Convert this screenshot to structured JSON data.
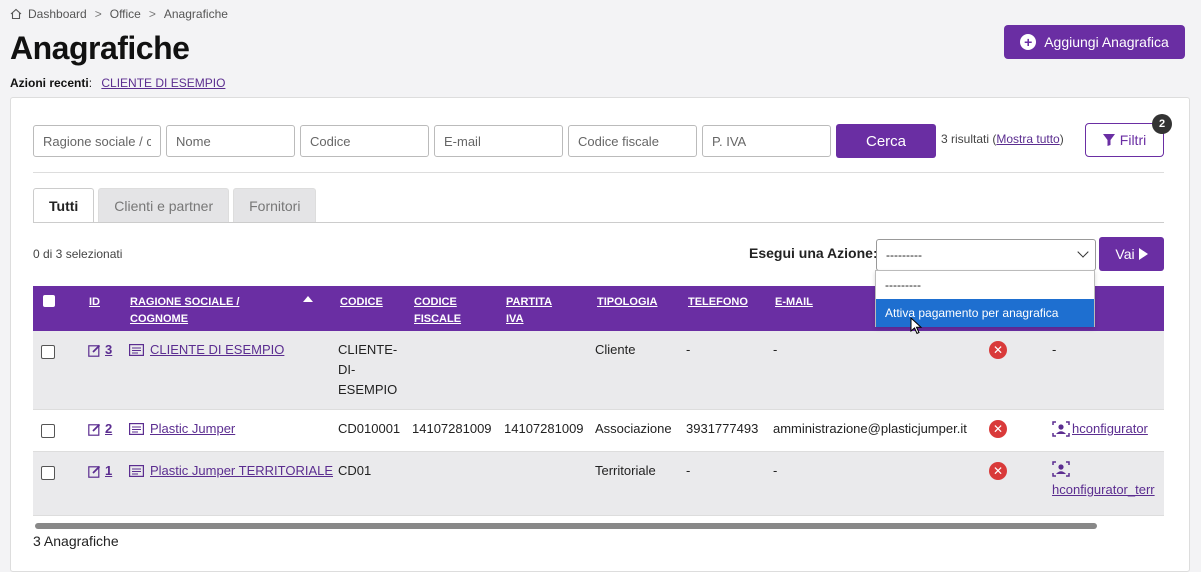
{
  "breadcrumb": [
    "Dashboard",
    "Office",
    "Anagrafiche"
  ],
  "breadcrumb_sep": ">",
  "page_title": "Anagrafiche",
  "recent": {
    "label": "Azioni recenti",
    "colon": ":",
    "item": "CLIENTE DI ESEMPIO"
  },
  "add_button": "Aggiungi Anagrafica",
  "search": {
    "placeholders": [
      "Ragione sociale / cognome",
      "Nome",
      "Codice",
      "E-mail",
      "Codice fiscale",
      "P. IVA"
    ],
    "button": "Cerca",
    "results_prefix": "3 risultati (",
    "show_all": "Mostra tutto",
    "results_suffix": ")",
    "filters_button": "Filtri",
    "filters_badge": "2"
  },
  "tabs": [
    "Tutti",
    "Clienti e partner",
    "Fornitori"
  ],
  "selected_count": "0 di 3 selezionati",
  "action": {
    "label": "Esegui una Azione:",
    "selected": "---------",
    "options": [
      "---------",
      "Attiva pagamento per anagrafica"
    ],
    "go_button": "Vai"
  },
  "table": {
    "headers": {
      "id": "ID",
      "ragione": [
        "RAGIONE SOCIALE /",
        "COGNOME"
      ],
      "codice": "CODICE",
      "cf": [
        "CODICE",
        "FISCALE"
      ],
      "piva": [
        "PARTITA",
        "IVA"
      ],
      "tipologia": "TIPOLOGIA",
      "telefono": "TELEFONO",
      "email": "E-MAIL"
    },
    "rows": [
      {
        "id": "3",
        "name": "CLIENTE DI ESEMPIO",
        "codice": [
          "CLIENTE-",
          "DI-",
          "ESEMPIO"
        ],
        "cf": "",
        "piva": "",
        "tipologia": "Cliente",
        "telefono": "-",
        "email": "-",
        "status": "✕",
        "user": "-"
      },
      {
        "id": "2",
        "name": "Plastic Jumper",
        "codice": [
          "CD010001"
        ],
        "cf": "14107281009",
        "piva": "14107281009",
        "tipologia": "Associazione",
        "telefono": "3931777493",
        "email": "amministrazione@plasticjumper.it",
        "status": "✕",
        "user": "hconfigurator"
      },
      {
        "id": "1",
        "name": "Plastic Jumper TERRITORIALE",
        "codice": [
          "CD01"
        ],
        "cf": "",
        "piva": "",
        "tipologia": "Territoriale",
        "telefono": "-",
        "email": "-",
        "status": "✕",
        "user": "hconfigurator_terr"
      }
    ]
  },
  "footer_count": "3 Anagrafiche",
  "colors": {
    "brand": "#6a2ea3",
    "danger": "#d93a3a",
    "highlight": "#1e6fd0"
  }
}
